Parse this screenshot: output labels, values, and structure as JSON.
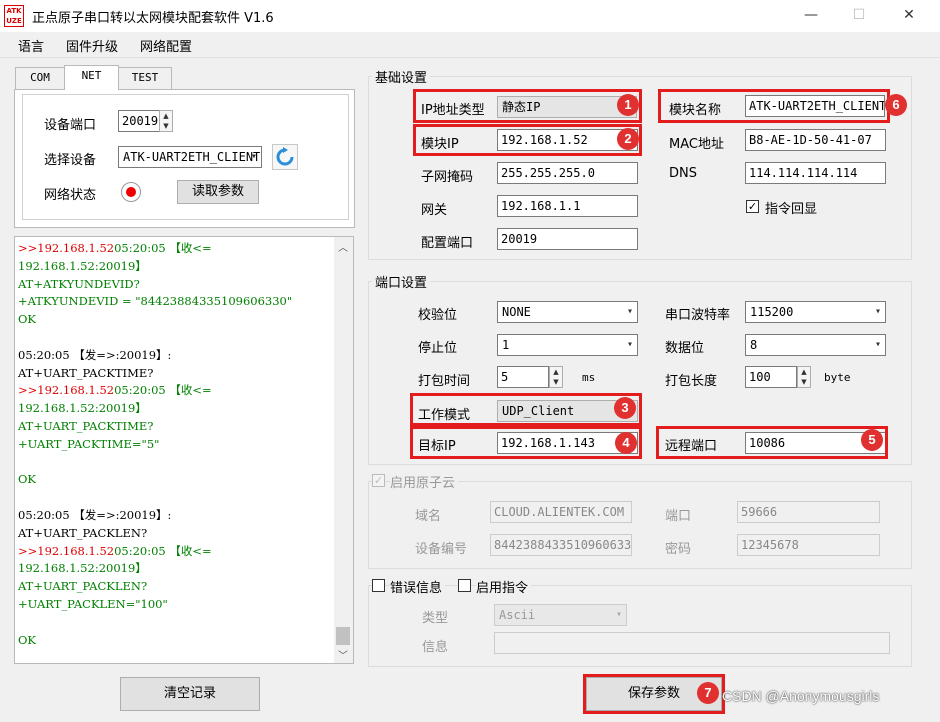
{
  "window": {
    "logo_text": "ATK UZE",
    "title": "正点原子串口转以太网模块配套软件 V1.6",
    "minimize": "—",
    "maximize": "☐",
    "close": "✕"
  },
  "menu": [
    "语言",
    "固件升级",
    "网络配置"
  ],
  "tabs": [
    "COM",
    "NET",
    "TEST"
  ],
  "net_panel": {
    "port_label": "设备端口",
    "port_value": "20019",
    "device_label": "选择设备",
    "device_value": "ATK-UART2ETH_CLIENT",
    "status_label": "网络状态",
    "read_button": "读取参数"
  },
  "log": [
    {
      "parts": [
        {
          "t": ">>192.168.1.52",
          "c": "red"
        },
        {
          "t": "05:20:05 【收<=",
          "c": "green"
        }
      ]
    },
    {
      "parts": [
        {
          "t": "192.168.1.52:20019】",
          "c": "green"
        }
      ]
    },
    {
      "parts": [
        {
          "t": "AT+ATKYUNDEVID?",
          "c": "green"
        }
      ]
    },
    {
      "parts": [
        {
          "t": "+ATKYUNDEVID = \"84423884335109606330\"",
          "c": "green"
        }
      ]
    },
    {
      "parts": [
        {
          "t": "OK",
          "c": "green"
        }
      ]
    },
    {
      "parts": [
        {
          "t": "",
          "c": "black"
        }
      ]
    },
    {
      "parts": [
        {
          "t": "05:20:05 【发=>:20019】:",
          "c": "black"
        }
      ]
    },
    {
      "parts": [
        {
          "t": "AT+UART_PACKTIME?",
          "c": "black"
        }
      ]
    },
    {
      "parts": [
        {
          "t": ">>192.168.1.52",
          "c": "red"
        },
        {
          "t": "05:20:05 【收<=",
          "c": "green"
        }
      ]
    },
    {
      "parts": [
        {
          "t": "192.168.1.52:20019】",
          "c": "green"
        }
      ]
    },
    {
      "parts": [
        {
          "t": "AT+UART_PACKTIME?",
          "c": "green"
        }
      ]
    },
    {
      "parts": [
        {
          "t": "+UART_PACKTIME=\"5\"",
          "c": "green"
        }
      ]
    },
    {
      "parts": [
        {
          "t": "",
          "c": "black"
        }
      ]
    },
    {
      "parts": [
        {
          "t": "OK",
          "c": "green"
        }
      ]
    },
    {
      "parts": [
        {
          "t": "",
          "c": "black"
        }
      ]
    },
    {
      "parts": [
        {
          "t": "05:20:05 【发=>:20019】:",
          "c": "black"
        }
      ]
    },
    {
      "parts": [
        {
          "t": "AT+UART_PACKLEN?",
          "c": "black"
        }
      ]
    },
    {
      "parts": [
        {
          "t": ">>192.168.1.52",
          "c": "red"
        },
        {
          "t": "05:20:05 【收<=",
          "c": "green"
        }
      ]
    },
    {
      "parts": [
        {
          "t": "192.168.1.52:20019】",
          "c": "green"
        }
      ]
    },
    {
      "parts": [
        {
          "t": "AT+UART_PACKLEN?",
          "c": "green"
        }
      ]
    },
    {
      "parts": [
        {
          "t": "+UART_PACKLEN=\"100\"",
          "c": "green"
        }
      ]
    },
    {
      "parts": [
        {
          "t": "",
          "c": "black"
        }
      ]
    },
    {
      "parts": [
        {
          "t": "OK",
          "c": "green"
        }
      ]
    }
  ],
  "clear_button": "清空记录",
  "basic": {
    "title": "基础设置",
    "ip_type_label": "IP地址类型",
    "ip_type_value": "静态IP",
    "module_ip_label": "模块IP",
    "module_ip_value": "192.168.1.52",
    "subnet_label": "子网掩码",
    "subnet_value": "255.255.255.0",
    "gateway_label": "网关",
    "gateway_value": "192.168.1.1",
    "config_port_label": "配置端口",
    "config_port_value": "20019",
    "module_name_label": "模块名称",
    "module_name_value": "ATK-UART2ETH_CLIENT",
    "mac_label": "MAC地址",
    "mac_value": "B8-AE-1D-50-41-07",
    "dns_label": "DNS",
    "dns_value": "114.114.114.114",
    "echo_label": "指令回显",
    "echo_checked": true
  },
  "port": {
    "title": "端口设置",
    "parity_label": "校验位",
    "parity_value": "NONE",
    "stop_label": "停止位",
    "stop_value": "1",
    "packtime_label": "打包时间",
    "packtime_value": "5",
    "packtime_unit": "ms",
    "mode_label": "工作模式",
    "mode_value": "UDP_Client",
    "target_ip_label": "目标IP",
    "target_ip_value": "192.168.1.143",
    "baud_label": "串口波特率",
    "baud_value": "115200",
    "databits_label": "数据位",
    "databits_value": "8",
    "packlen_label": "打包长度",
    "packlen_value": "100",
    "packlen_unit": "byte",
    "remote_port_label": "远程端口",
    "remote_port_value": "10086"
  },
  "cloud": {
    "enable_label": "启用原子云",
    "enabled": true,
    "domain_label": "域名",
    "domain_value": "CLOUD.ALIENTEK.COM",
    "devid_label": "设备编号",
    "devid_value": "84423884335109606330",
    "port_label": "端口",
    "port_value": "59666",
    "pwd_label": "密码",
    "pwd_value": "12345678"
  },
  "error": {
    "error_info_label": "错误信息",
    "enable_cmd_label": "启用指令",
    "type_label": "类型",
    "type_value": "Ascii",
    "info_label": "信息"
  },
  "save_button": "保存参数",
  "badges": [
    "1",
    "2",
    "3",
    "4",
    "5",
    "6",
    "7"
  ],
  "watermark": "CSDN @Anonymousgirls"
}
